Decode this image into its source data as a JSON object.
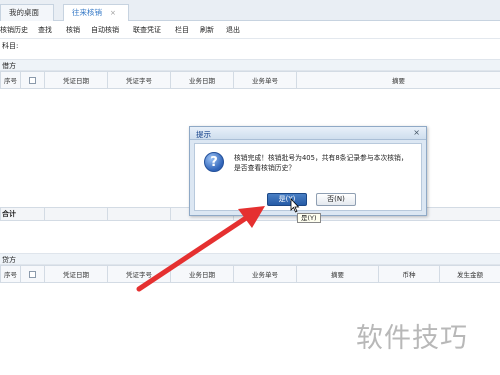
{
  "tabs": [
    {
      "label": "我的桌面",
      "active": false
    },
    {
      "label": "往来核销",
      "active": true,
      "close": "×"
    }
  ],
  "toolbar": [
    "核销历史",
    "查找",
    "核销",
    "自动核销",
    "联查凭证",
    "栏目",
    "刷新",
    "退出"
  ],
  "subject_label": "科目:",
  "debit_section": "借方",
  "credit_section": "贷方",
  "debit_columns": [
    "序号",
    "",
    "凭证日期",
    "凭证字号",
    "业务日期",
    "业务单号",
    "摘要"
  ],
  "total_label": "合计",
  "credit_columns": [
    "序号",
    "",
    "凭证日期",
    "凭证字号",
    "业务日期",
    "业务单号",
    "摘要",
    "币种",
    "发生金额"
  ],
  "dialog": {
    "title": "提示",
    "close": "×",
    "icon": "question-icon",
    "icon_glyph": "?",
    "message": "核销完成！核销批号为405，共有8条记录参与本次核销，是否查看核销历史？",
    "yes_label": "是(Y)",
    "no_label": "否(N)",
    "tooltip": "是(Y)"
  },
  "annotation_arrow_color": "#e53030",
  "watermark": "软件技巧"
}
